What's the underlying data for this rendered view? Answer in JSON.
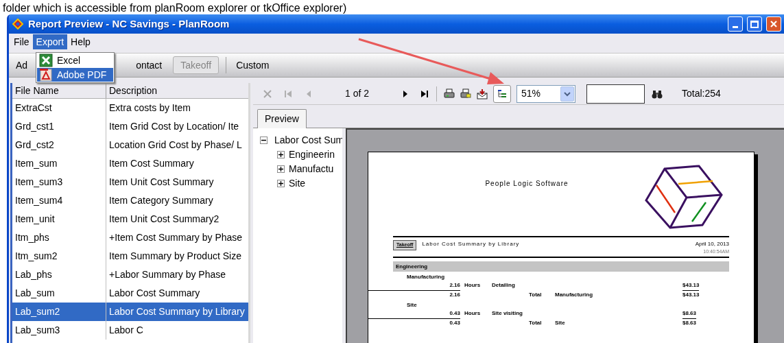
{
  "caption": "folder which is accessible from planRoom explorer or tkOffice explorer)",
  "window": {
    "title": "Report Preview - NC Savings - PlanRoom"
  },
  "menu": [
    {
      "label": "File",
      "selected": false
    },
    {
      "label": "Export",
      "selected": true
    },
    {
      "label": "Help",
      "selected": false
    }
  ],
  "export_menu": [
    {
      "label": "Excel",
      "kind": "excel",
      "selected": false
    },
    {
      "label": "Adobe PDF",
      "kind": "pdf",
      "selected": true
    }
  ],
  "toolbar": [
    {
      "label": "Ad",
      "disabled": false
    },
    {
      "label": "ontact",
      "disabled": false
    },
    {
      "label": "Takeoff",
      "disabled": true
    },
    {
      "label": "Custom",
      "disabled": false
    }
  ],
  "report_list": {
    "columns": [
      "File Name",
      "Description"
    ],
    "rows": [
      {
        "file": "ExtraCst",
        "description": "Extra costs by Item",
        "selected": false
      },
      {
        "file": "Grd_cst1",
        "description": "Item Grid Cost by Location/ Ite",
        "selected": false
      },
      {
        "file": "Grd_cst2",
        "description": "Location Grid Cost by Phase/ L",
        "selected": false
      },
      {
        "file": "Item_sum",
        "description": "Item Cost Summary",
        "selected": false
      },
      {
        "file": "Item_sum3",
        "description": "Item Unit Cost Summary",
        "selected": false
      },
      {
        "file": "Item_sum4",
        "description": "Item Category Summary",
        "selected": false
      },
      {
        "file": "Item_unit",
        "description": "Item Unit Cost Summary2",
        "selected": false
      },
      {
        "file": "Itm_phs",
        "description": "+Item Cost Summary by Phase",
        "selected": false
      },
      {
        "file": "Itm_sum2",
        "description": "Item Summary by Product Size",
        "selected": false
      },
      {
        "file": "Lab_phs",
        "description": "+Labor Summary by Phase",
        "selected": false
      },
      {
        "file": "Lab_sum",
        "description": "Labor Cost Summary",
        "selected": false
      },
      {
        "file": "Lab_sum2",
        "description": "Labor Cost Summary by Library",
        "selected": true
      },
      {
        "file": "Lab_sum3",
        "description": "Labor C",
        "selected": false
      }
    ]
  },
  "preview_toolbar": {
    "page": "1 of 2",
    "zoom": "51%",
    "total": "Total:254"
  },
  "tabs": [
    {
      "label": "Preview",
      "selected": true
    }
  ],
  "tree": {
    "label": "Labor Cost Sum",
    "expanded": true,
    "children": [
      {
        "label": "Engineerin",
        "expanded": false
      },
      {
        "label": "Manufactu",
        "expanded": false
      },
      {
        "label": "Site",
        "expanded": false
      }
    ]
  },
  "report_page": {
    "company": "People Logic Software",
    "stamp": "Takeoff",
    "title": "Labor Cost Summary by Library",
    "date": "April 10, 2013",
    "time": "10:40:54AM",
    "section": "Engineering",
    "groups": [
      {
        "name": "Manufacturing",
        "lines": [
          {
            "hours": "2.16",
            "unit": "Hours",
            "task": "Detailing",
            "amount": "$43.13"
          }
        ],
        "subtotal": {
          "hours": "2.16",
          "label": "Total",
          "group": "Manufacturing",
          "amount": "$43.13"
        }
      },
      {
        "name": "Site",
        "lines": [
          {
            "hours": "0.43",
            "unit": "Hours",
            "task": "Site visiting",
            "amount": "$8.63"
          }
        ],
        "subtotal": {
          "hours": "0.43",
          "label": "Total",
          "group": "Site",
          "amount": "$8.63"
        }
      }
    ]
  }
}
